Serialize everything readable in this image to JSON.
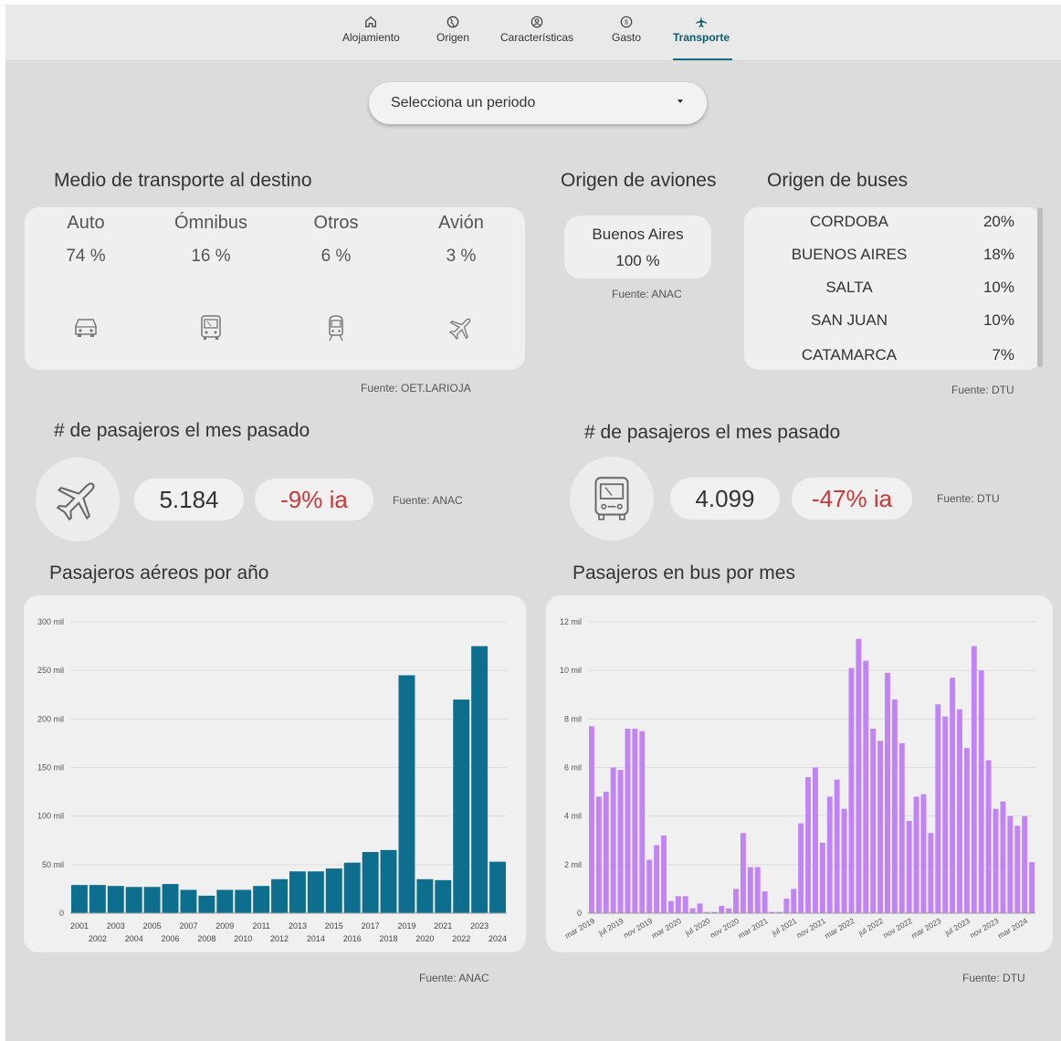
{
  "nav": {
    "items": [
      {
        "label": "Alojamiento",
        "icon": "home-icon"
      },
      {
        "label": "Origen",
        "icon": "globe-icon"
      },
      {
        "label": "Características",
        "icon": "person-circle-icon"
      },
      {
        "label": "Gasto",
        "icon": "dollar-circle-icon"
      },
      {
        "label": "Transporte",
        "icon": "airplane-icon"
      }
    ],
    "active": "Transporte"
  },
  "period": {
    "placeholder": "Selecciona un periodo"
  },
  "transport_modes": {
    "title": "Medio de transporte al destino",
    "items": [
      {
        "name": "Auto",
        "pct": "74 %",
        "icon": "car-icon"
      },
      {
        "name": "Ómnibus",
        "pct": "16 %",
        "icon": "bus-icon"
      },
      {
        "name": "Otros",
        "pct": "6 %",
        "icon": "train-icon"
      },
      {
        "name": "Avión",
        "pct": "3 %",
        "icon": "plane-icon"
      }
    ],
    "source": "Fuente: OET.LARIOJA"
  },
  "plane_origin": {
    "title": "Origen de aviones",
    "city": "Buenos Aires",
    "pct": "100 %",
    "source": "Fuente: ANAC"
  },
  "bus_origin": {
    "title": "Origen de buses",
    "rows": [
      {
        "name": "CORDOBA",
        "pct": "20%"
      },
      {
        "name": "BUENOS AIRES",
        "pct": "18%"
      },
      {
        "name": "SALTA",
        "pct": "10%"
      },
      {
        "name": "SAN JUAN",
        "pct": "10%"
      },
      {
        "name": "CATAMARCA",
        "pct": "7%"
      }
    ],
    "source": "Fuente: DTU"
  },
  "plane_passengers": {
    "title": "# de pasajeros el mes pasado",
    "value": "5.184",
    "change": "-9% ia",
    "source": "Fuente: ANAC"
  },
  "bus_passengers": {
    "title": "# de pasajeros el mes pasado",
    "value": "4.099",
    "change": "-47% ia",
    "source": "Fuente: DTU"
  },
  "chart_data": [
    {
      "type": "bar",
      "title": "Pasajeros aéreos por año",
      "source": "Fuente: ANAC",
      "color": "#0e6e8e",
      "ylim": [
        0,
        300
      ],
      "yticks": [
        "0",
        "50 mil",
        "100 mil",
        "150 mil",
        "200 mil",
        "250 mil",
        "300 mil"
      ],
      "categories": [
        "2001",
        "2002",
        "2003",
        "2004",
        "2005",
        "2006",
        "2007",
        "2008",
        "2009",
        "2010",
        "2011",
        "2012",
        "2013",
        "2014",
        "2015",
        "2016",
        "2017",
        "2018",
        "2019",
        "2020",
        "2021",
        "2022",
        "2023",
        "2024"
      ],
      "values": [
        29,
        29,
        28,
        27,
        27,
        30,
        24,
        18,
        24,
        24,
        28,
        35,
        43,
        43,
        46,
        52,
        63,
        65,
        245,
        35,
        34,
        220,
        275,
        53
      ]
    },
    {
      "type": "bar",
      "title": "Pasajeros en bus por mes",
      "source": "Fuente: DTU",
      "color": "#c084f5",
      "ylim": [
        0,
        12
      ],
      "yticks": [
        "0",
        "2 mil",
        "4 mil",
        "6 mil",
        "8 mil",
        "10 mil",
        "12 mil"
      ],
      "xtick_labels": [
        "mar 2019",
        "jul 2019",
        "nov 2019",
        "mar 2020",
        "jul 2020",
        "nov 2020",
        "mar 2021",
        "jul 2021",
        "nov 2021",
        "mar 2022",
        "jul 2022",
        "nov 2022",
        "mar 2023",
        "jul 2023",
        "nov 2023",
        "mar 2024"
      ],
      "values": [
        7.7,
        4.8,
        5.0,
        6.0,
        5.9,
        7.6,
        7.6,
        7.5,
        2.2,
        2.8,
        3.2,
        0.5,
        0.7,
        0.7,
        0.2,
        0.4,
        0.05,
        0.05,
        0.3,
        0.2,
        1.0,
        3.3,
        1.9,
        1.9,
        0.9,
        0.05,
        0.05,
        0.6,
        1.0,
        3.7,
        5.6,
        6.0,
        2.9,
        4.8,
        5.5,
        4.3,
        10.1,
        11.3,
        10.4,
        7.6,
        7.1,
        9.9,
        8.8,
        7.0,
        3.8,
        4.8,
        4.9,
        3.3,
        8.6,
        8.1,
        9.7,
        8.4,
        6.8,
        11.0,
        10.0,
        6.3,
        4.3,
        4.6,
        4.0,
        3.6,
        4.0,
        2.1
      ]
    }
  ]
}
